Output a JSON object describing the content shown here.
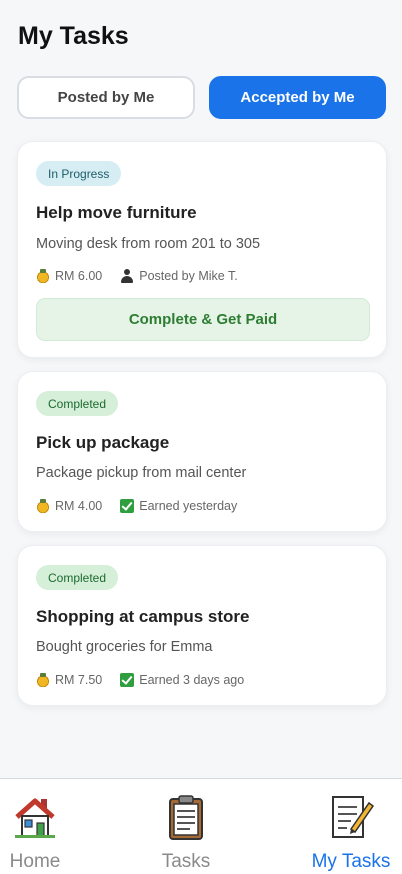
{
  "header": {
    "title": "My Tasks"
  },
  "segments": {
    "posted_label": "Posted by Me",
    "accepted_label": "Accepted by Me"
  },
  "tasks": [
    {
      "status": "In Progress",
      "title": "Help move furniture",
      "description": "Moving desk from room 201 to 305",
      "amount": "RM 6.00",
      "meta": "Posted by Mike T.",
      "action": "Complete & Get Paid"
    },
    {
      "status": "Completed",
      "title": "Pick up package",
      "description": "Package pickup from mail center",
      "amount": "RM 4.00",
      "meta": "Earned yesterday"
    },
    {
      "status": "Completed",
      "title": "Shopping at campus store",
      "description": "Bought groceries for Emma",
      "amount": "RM 7.50",
      "meta": "Earned 3 days ago"
    }
  ],
  "nav": {
    "active": "My Tasks",
    "items": [
      {
        "label": "Home",
        "icon": "house-icon"
      },
      {
        "label": "Tasks",
        "icon": "clipboard-icon"
      },
      {
        "label": "My Tasks",
        "icon": "memo-icon"
      }
    ]
  },
  "colors": {
    "accent": "#1a73e8",
    "success": "#2e7d32",
    "in_progress_badge": "#d6eef3",
    "completed_badge": "#d5efd9"
  }
}
